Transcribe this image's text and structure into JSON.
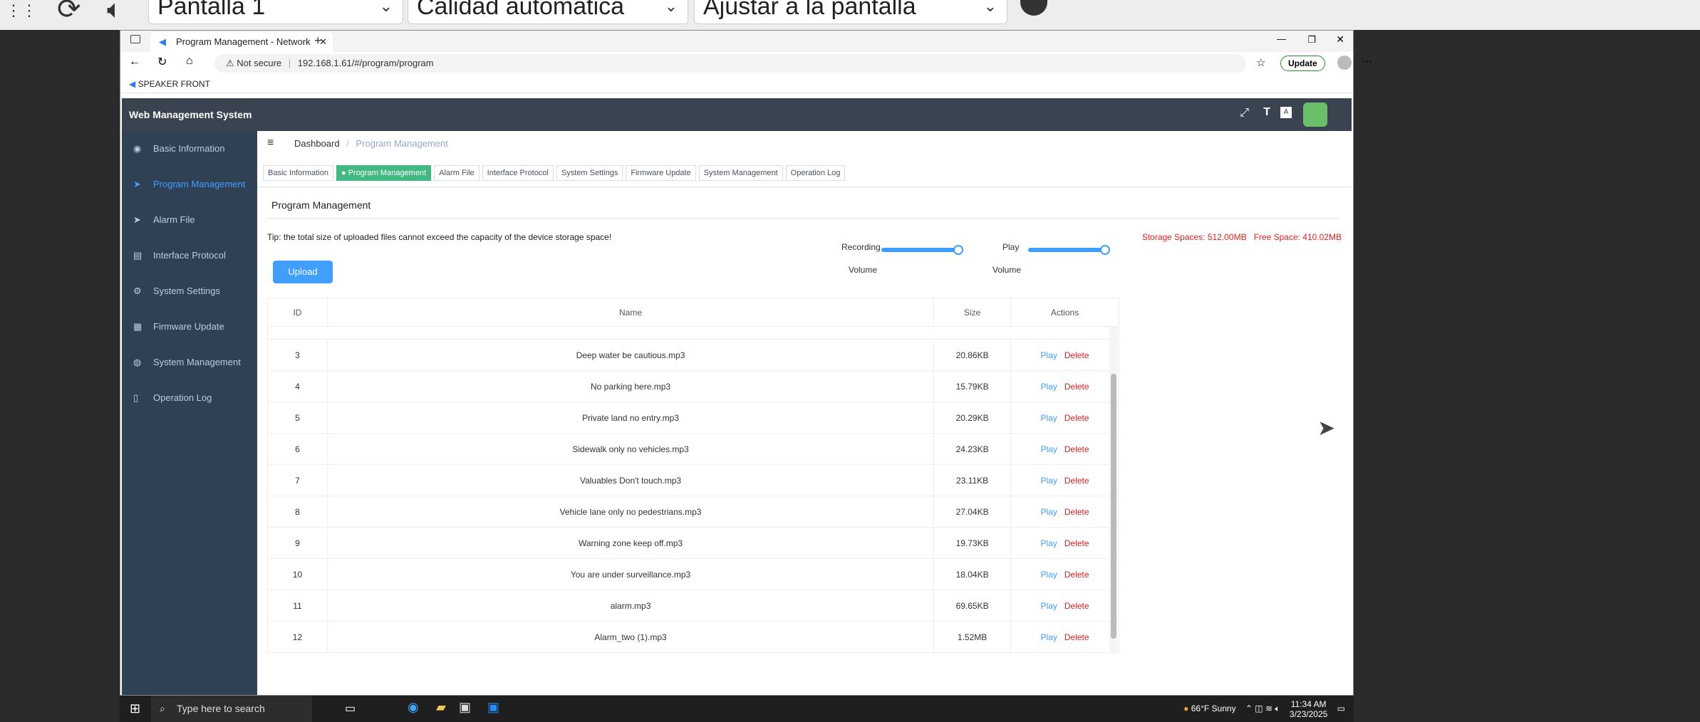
{
  "remote_toolbar": {
    "display": "Pantalla 1",
    "quality": "Calidad automática",
    "scale": "Ajustar a la pantalla"
  },
  "browser": {
    "tab_title": "Program Management - Network",
    "security": "Not secure",
    "url": "192.168.1.61/#/program/program",
    "update": "Update",
    "bookmark": "SPEAKER FRONT"
  },
  "app": {
    "brand": "Web Management System",
    "sidebar": [
      "Basic Information",
      "Program Management",
      "Alarm File",
      "Interface Protocol",
      "System Settings",
      "Firmware Update",
      "System Management",
      "Operation Log"
    ],
    "breadcrumb": {
      "home": "Dashboard",
      "sep": "/",
      "current": "Program Management"
    },
    "tabs": [
      "Basic Information",
      "Program Management",
      "Alarm File",
      "Interface Protocol",
      "System Settings",
      "Firmware Update",
      "System Management",
      "Operation Log"
    ],
    "page_title": "Program Management",
    "tip": "Tip: the total size of uploaded files cannot exceed the capacity of the device storage space!",
    "storage": "Storage Spaces: 512.00MB",
    "free": "Free Space: 410.02MB",
    "upload": "Upload",
    "recording_label": "Recording",
    "play_label": "Play",
    "volume": "Volume",
    "recording_volume": 1.0,
    "play_volume": 1.0,
    "table": {
      "headers": [
        "ID",
        "Name",
        "Size",
        "Actions"
      ],
      "rows": [
        [
          "3",
          "Deep water be cautious.mp3",
          "20.86KB"
        ],
        [
          "4",
          "No parking here.mp3",
          "15.79KB"
        ],
        [
          "5",
          "Private land no entry.mp3",
          "20.29KB"
        ],
        [
          "6",
          "Sidewalk only no vehicles.mp3",
          "24.23KB"
        ],
        [
          "7",
          "Valuables Don't touch.mp3",
          "23.11KB"
        ],
        [
          "8",
          "Vehicle lane only no pedestrians.mp3",
          "27.04KB"
        ],
        [
          "9",
          "Warning zone keep off.mp3",
          "19.73KB"
        ],
        [
          "10",
          "You are under surveillance.mp3",
          "18.04KB"
        ],
        [
          "11",
          "alarm.mp3",
          "69.65KB"
        ],
        [
          "12",
          "Alarm_two (1).mp3",
          "1.52MB"
        ]
      ],
      "play": "Play",
      "delete": "Delete"
    }
  },
  "taskbar": {
    "search": "Type here to search",
    "weather": "66°F  Sunny",
    "time": "11:34 AM",
    "date": "3/23/2025"
  }
}
